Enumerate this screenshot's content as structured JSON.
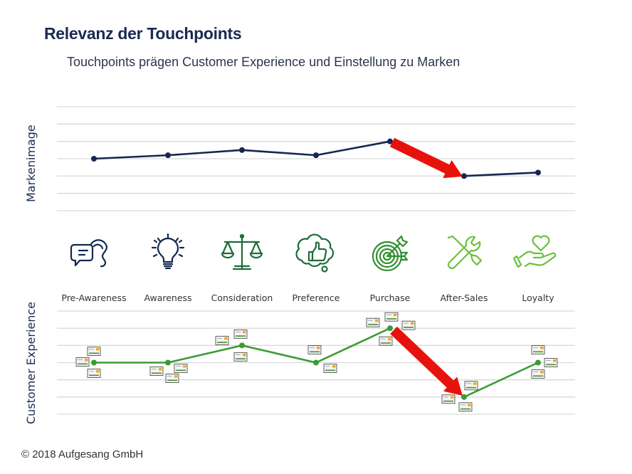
{
  "header": {
    "title": "Relevanz der Touchpoints",
    "subtitle": "Touchpoints prägen Customer Experience und Einstellung zu Marken"
  },
  "footer": {
    "copyright": "© 2018 Aufgesang GmbH"
  },
  "colors": {
    "title": "#1a2a52",
    "brand_line": "#14284f",
    "cx_line": "#3c9a35",
    "arrow": "#e8120c",
    "grid": "#d9d9d9",
    "icon_dark_navy": "#14284f",
    "icon_dark_green": "#1e6b3a",
    "icon_green": "#2f8f2f",
    "icon_light_green": "#6cbf3c"
  },
  "stages": [
    {
      "label": "Pre-Awareness",
      "icon": "chat-ear-icon",
      "icon_color": "icon_dark_navy"
    },
    {
      "label": "Awareness",
      "icon": "lightbulb-icon",
      "icon_color": "icon_dark_navy"
    },
    {
      "label": "Consideration",
      "icon": "scales-icon",
      "icon_color": "icon_dark_green"
    },
    {
      "label": "Preference",
      "icon": "thumbs-up-thought-icon",
      "icon_color": "icon_dark_green"
    },
    {
      "label": "Purchase",
      "icon": "target-arrow-icon",
      "icon_color": "icon_green"
    },
    {
      "label": "After-Sales",
      "icon": "wrench-screwdriver-icon",
      "icon_color": "icon_light_green"
    },
    {
      "label": "Loyalty",
      "icon": "heart-hand-icon",
      "icon_color": "icon_light_green"
    }
  ],
  "chart_data": [
    {
      "type": "line",
      "title": "",
      "ylabel": "Markenimage",
      "xlabel": "",
      "categories": [
        "Pre-Awareness",
        "Awareness",
        "Consideration",
        "Preference",
        "Purchase",
        "After-Sales",
        "Loyalty"
      ],
      "series": [
        {
          "name": "Markenimage",
          "values": [
            3.0,
            3.2,
            3.5,
            3.2,
            4.0,
            2.0,
            2.2
          ]
        }
      ],
      "ylim": [
        0,
        6
      ],
      "grid": true,
      "annotations": [
        {
          "type": "arrow",
          "from": "Purchase",
          "to": "After-Sales",
          "meaning": "drop"
        }
      ]
    },
    {
      "type": "line",
      "title": "",
      "ylabel": "Customer Experience",
      "xlabel": "",
      "categories": [
        "Pre-Awareness",
        "Awareness",
        "Consideration",
        "Preference",
        "Purchase",
        "After-Sales",
        "Loyalty"
      ],
      "series": [
        {
          "name": "Customer Experience",
          "values": [
            3,
            3,
            4,
            3,
            5,
            1,
            3
          ]
        }
      ],
      "ylim": [
        0,
        6
      ],
      "grid": true,
      "touchpoint_cards_per_stage": [
        3,
        3,
        3,
        2,
        4,
        3,
        3
      ],
      "annotations": [
        {
          "type": "arrow",
          "from": "Purchase",
          "to": "After-Sales",
          "meaning": "drop"
        }
      ]
    }
  ]
}
